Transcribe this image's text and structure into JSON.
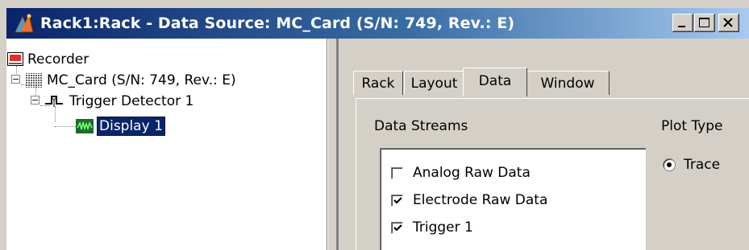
{
  "window": {
    "title": "Rack1:Rack - Data Source: MC_Card (S/N: 749, Rev.: E)",
    "controls": {
      "minimize": "minimize-icon",
      "maximize": "maximize-icon",
      "close": "close-icon"
    },
    "colors": {
      "titlebar_start": "#0a246a",
      "titlebar_end": "#a6caf0",
      "face": "#d4d0c8",
      "selection": "#0a246a"
    }
  },
  "tree": {
    "items": [
      {
        "label": "Recorder",
        "icon": "recorder-icon",
        "expander": ""
      },
      {
        "label": "MC_Card (S/N: 749, Rev.: E)",
        "icon": "card-icon",
        "expander": "−"
      },
      {
        "label": "Trigger Detector 1",
        "icon": "trigger-detector-icon",
        "expander": "−"
      },
      {
        "label": "Display 1",
        "icon": "display-icon",
        "selected": true
      }
    ]
  },
  "tabs": [
    {
      "label": "Rack",
      "active": false
    },
    {
      "label": "Layout",
      "active": false
    },
    {
      "label": "Data",
      "active": true
    },
    {
      "label": "Window",
      "active": false
    }
  ],
  "data_tab": {
    "data_streams_label": "Data Streams",
    "plot_type_label": "Plot Type",
    "streams": [
      {
        "label": "Analog Raw Data",
        "checked": false
      },
      {
        "label": "Electrode Raw Data",
        "checked": true
      },
      {
        "label": "Trigger 1",
        "checked": true
      }
    ],
    "plot_type_options": [
      {
        "label": "Trace",
        "selected": true
      }
    ]
  }
}
